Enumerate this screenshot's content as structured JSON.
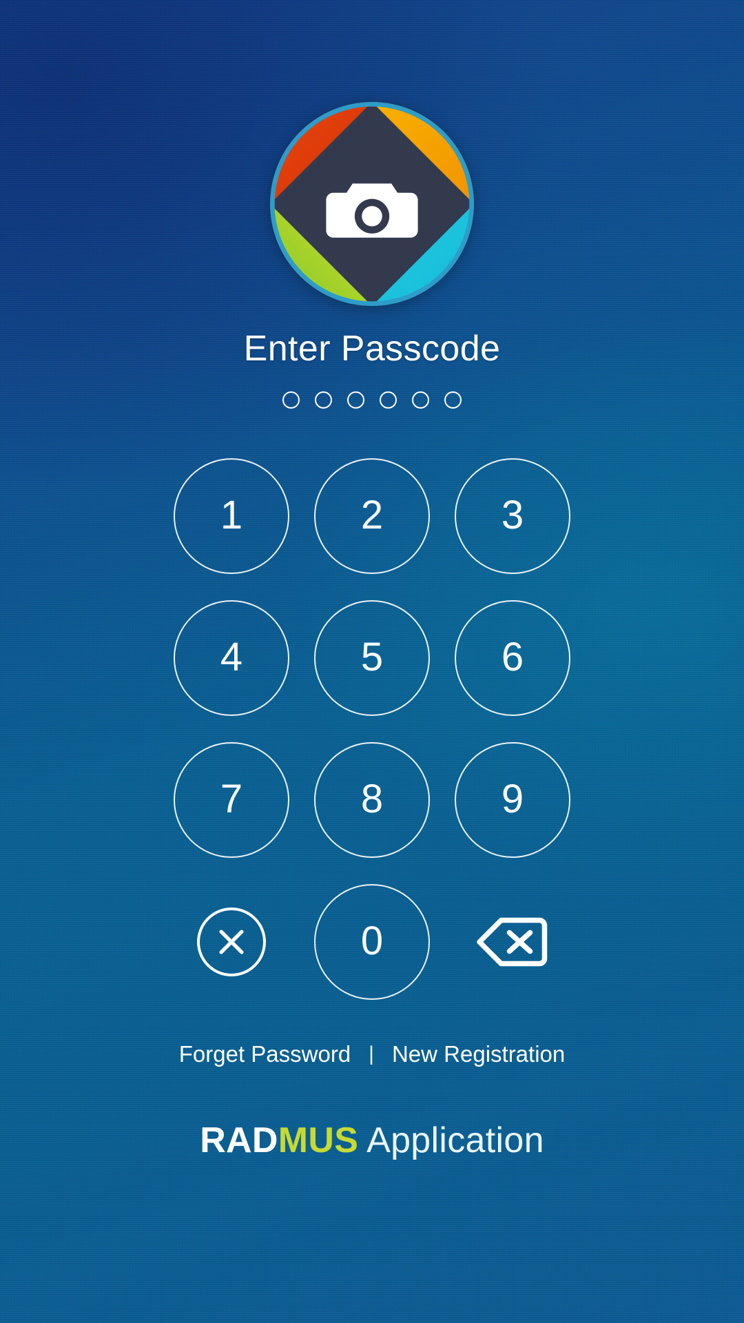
{
  "app": {
    "brand_primary": "RAD",
    "brand_accent": "MUS",
    "brand_suffix": " Application",
    "accent_color": "#c6da33",
    "background_color": "#0a6092"
  },
  "logo": {
    "icon_name": "camera-icon",
    "colors": {
      "top_left": "#e03a0c",
      "top_right": "#f5a300",
      "bottom_right": "#20c4dd",
      "bottom_left": "#9ec92c",
      "center": "#343a4e",
      "ring": "#2e9cc9"
    }
  },
  "header": {
    "title": "Enter Passcode"
  },
  "passcode": {
    "length": 6,
    "entered": 0,
    "dots": [
      "",
      "",
      "",
      "",
      "",
      ""
    ]
  },
  "keypad": {
    "keys": [
      {
        "label": "1",
        "name": "key-1"
      },
      {
        "label": "2",
        "name": "key-2"
      },
      {
        "label": "3",
        "name": "key-3"
      },
      {
        "label": "4",
        "name": "key-4"
      },
      {
        "label": "5",
        "name": "key-5"
      },
      {
        "label": "6",
        "name": "key-6"
      },
      {
        "label": "7",
        "name": "key-7"
      },
      {
        "label": "8",
        "name": "key-8"
      },
      {
        "label": "9",
        "name": "key-9"
      },
      {
        "label": "0",
        "name": "key-0"
      }
    ],
    "cancel_icon": "close-circle-icon",
    "backspace_icon": "backspace-icon"
  },
  "footer": {
    "forget_password": "Forget Password",
    "separator": "|",
    "new_registration": "New Registration"
  }
}
